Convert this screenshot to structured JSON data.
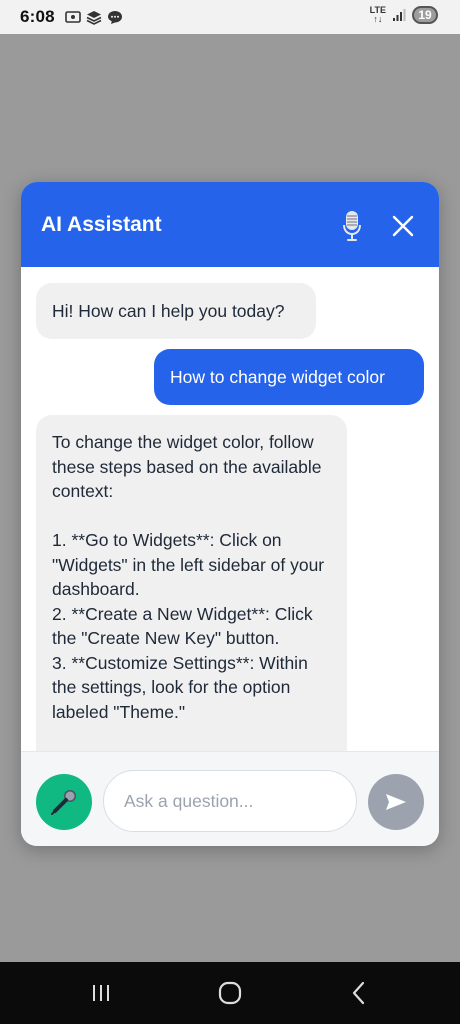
{
  "status_bar": {
    "time": "6:08",
    "network": "LTE",
    "battery": "19",
    "icons": [
      "screenshot-icon",
      "app-stack-icon",
      "chat-notification-icon",
      "signal-icon",
      "battery-icon"
    ]
  },
  "assistant": {
    "title": "AI Assistant",
    "header_icons": [
      "microphone-icon",
      "close-icon"
    ],
    "messages": [
      {
        "role": "bot",
        "text": "Hi! How can I help you today?"
      },
      {
        "role": "user",
        "text": "How to change widget color"
      },
      {
        "role": "bot",
        "text": "To change the widget color, follow these steps based on the available context:\n\n1. **Go to Widgets**: Click on \"Widgets\" in the left sidebar of your dashboard.\n2. **Create a New Widget**: Click the \"Create New Key\" button.\n3. **Customize Settings**: Within the settings, look for the option labeled \"Theme.\""
      }
    ],
    "input": {
      "value": "",
      "placeholder": "Ask a question..."
    },
    "buttons": [
      "mic-button",
      "send-button"
    ]
  },
  "colors": {
    "primary": "#2563eb",
    "mic_button": "#10b981",
    "send_button_disabled": "#9ca3af",
    "bot_bubble": "#f0f0f1",
    "overlay": "#9a9a9a"
  },
  "nav_bar": {
    "buttons": [
      "recent-apps-button",
      "home-button",
      "back-button"
    ]
  }
}
